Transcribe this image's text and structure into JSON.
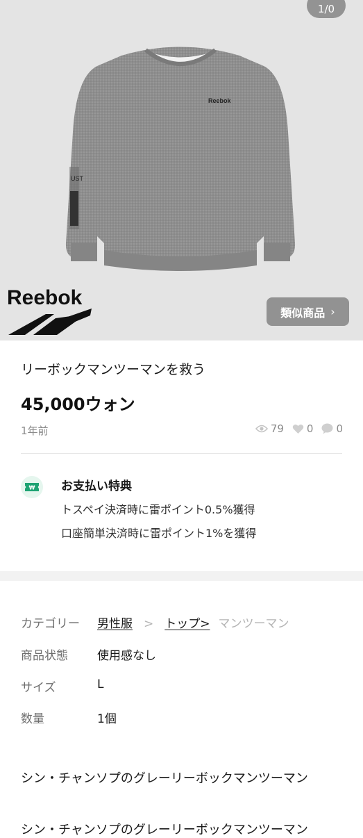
{
  "gallery": {
    "counter": "1/0",
    "brand": "Reebok",
    "similar_label": "類似商品",
    "chevron": "›"
  },
  "product": {
    "title": "リーボックマンツーマンを救う",
    "price": "45,000ウォン",
    "posted": "1年前",
    "views": "79",
    "likes": "0",
    "chats": "0"
  },
  "benefit": {
    "title": "お支払い特典",
    "line1": "トスペイ決済時に雷ポイント0.5%獲得",
    "line2": "口座簡単決済時に雷ポイント1%を獲得",
    "icon": "₩"
  },
  "details": {
    "category_label": "カテゴリー",
    "category_1": "男性服",
    "category_sep": ">",
    "category_2": "トップ>",
    "category_3": "マンツーマン",
    "condition_label": "商品状態",
    "condition_value": "使用感なし",
    "size_label": "サイズ",
    "size_value": "L",
    "quantity_label": "数量",
    "quantity_value": "1個"
  },
  "description": {
    "text": "シン・チャンソプのグレーリーボックマンツーマン",
    "cut_line": "シン・チャンソプのグレーリーボックマンツーマン"
  }
}
